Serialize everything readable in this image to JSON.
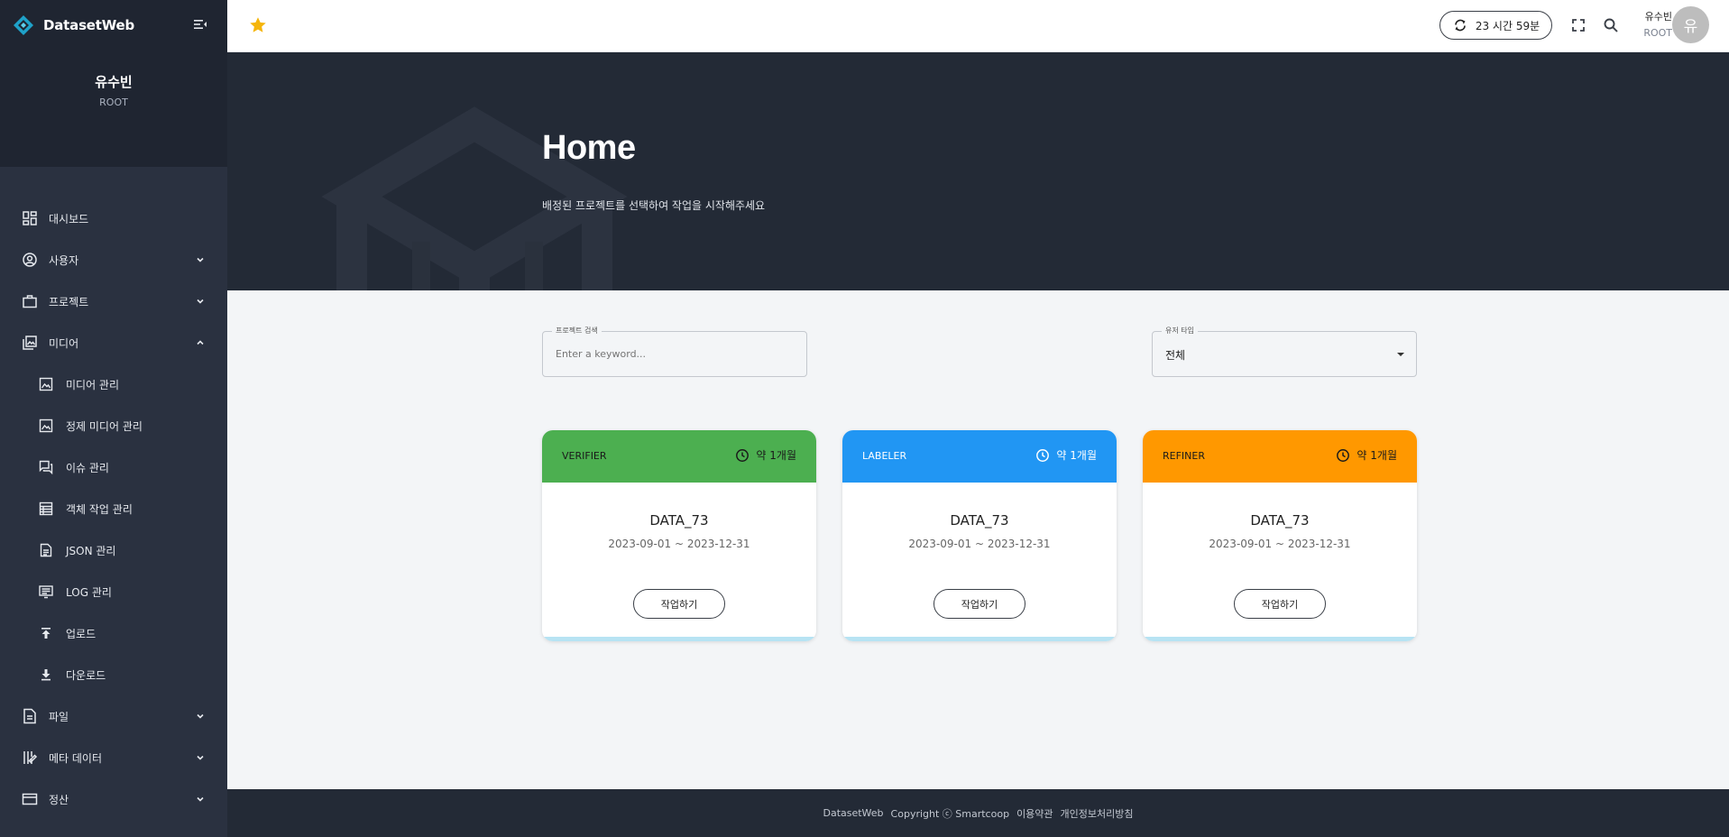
{
  "app": {
    "name": "DatasetWeb"
  },
  "sidebar": {
    "user_name": "유수빈",
    "user_role": "ROOT",
    "items": [
      {
        "label": "대시보드",
        "icon": "dashboard-icon"
      },
      {
        "label": "사용자",
        "icon": "user-icon",
        "expand": "down"
      },
      {
        "label": "프로젝트",
        "icon": "briefcase-icon",
        "expand": "down"
      },
      {
        "label": "미디어",
        "icon": "media-library-icon",
        "expand": "up"
      },
      {
        "label": "미디어 관리",
        "icon": "image-icon",
        "sub": true
      },
      {
        "label": "정제 미디어 관리",
        "icon": "image-icon",
        "sub": true
      },
      {
        "label": "이슈 관리",
        "icon": "chat-icon",
        "sub": true
      },
      {
        "label": "객체 작업 관리",
        "icon": "table-icon",
        "sub": true
      },
      {
        "label": "JSON 관리",
        "icon": "document-icon",
        "sub": true
      },
      {
        "label": "LOG 관리",
        "icon": "log-icon",
        "sub": true
      },
      {
        "label": "업로드",
        "icon": "upload-icon",
        "sub": true
      },
      {
        "label": "다운로드",
        "icon": "download-icon",
        "sub": true
      },
      {
        "label": "파일",
        "icon": "file-icon",
        "expand": "down"
      },
      {
        "label": "메타 데이터",
        "icon": "metadata-icon",
        "expand": "down"
      },
      {
        "label": "정산",
        "icon": "card-icon",
        "expand": "down"
      }
    ]
  },
  "topbar": {
    "session_time": "23 시간 59분",
    "user_name": "유수빈",
    "user_role": "ROOT",
    "avatar_initial": "유"
  },
  "hero": {
    "title": "Home",
    "subtitle": "배정된 프로젝트를 선택하여 작업을 시작해주세요"
  },
  "filters": {
    "search_label": "프로젝트 검색",
    "search_placeholder": "Enter a keyword...",
    "role_label": "유저 타입",
    "role_value": "전체"
  },
  "cards": [
    {
      "role": "VERIFIER",
      "time": "약 1개월",
      "title": "DATA_73",
      "date": "2023-09-01 ~ 2023-12-31",
      "button": "작업하기",
      "color": "#4caf50",
      "text_color": "#1a1a1a"
    },
    {
      "role": "LABELER",
      "time": "약 1개월",
      "title": "DATA_73",
      "date": "2023-09-01 ~ 2023-12-31",
      "button": "작업하기",
      "color": "#2196f3",
      "text_color": "#ffffff"
    },
    {
      "role": "REFINER",
      "time": "약 1개월",
      "title": "DATA_73",
      "date": "2023-09-01 ~ 2023-12-31",
      "button": "작업하기",
      "color": "#ff9800",
      "text_color": "#1a1a1a"
    }
  ],
  "footer": {
    "brand": "DatasetWeb",
    "copyright": "Copyright ⓒ Smartcoop",
    "terms": "이용약관",
    "privacy": "개인정보처리방침"
  }
}
